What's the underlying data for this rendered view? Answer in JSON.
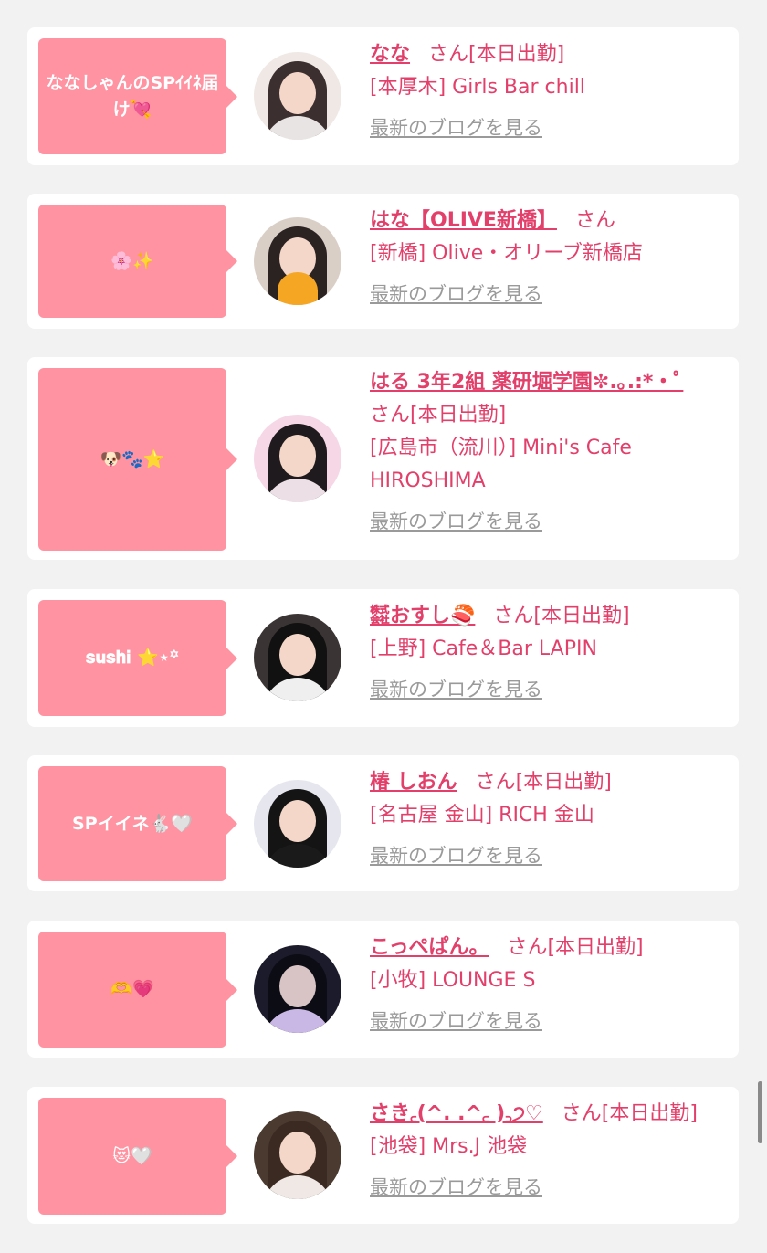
{
  "colors": {
    "accent": "#e2406b",
    "bubble": "#ff93a1",
    "link_gray": "#9a9a9a"
  },
  "blog_link_label": "最新のブログを見る",
  "cards": [
    {
      "message": "ななしゃんのSPｲｲﾈ届け💘",
      "name": "なな",
      "status": "さん[本日出勤]",
      "shop_line1": "[本厚木] Girls Bar chill",
      "shop_line2": "",
      "blog": "最新のブログを見る",
      "avatar_colors": [
        "#efe8e4",
        "#3b2f2f",
        "#f1d9cf"
      ]
    },
    {
      "message": "🌸✨",
      "name": "はな【OLIVE新橋】",
      "status": "さん",
      "shop_line1": "[新橋] Olive・オリーブ新橋店",
      "shop_line2": "",
      "blog": "最新のブログを見る",
      "avatar_colors": [
        "#d9cfc6",
        "#2b2222",
        "#f5a623"
      ]
    },
    {
      "message": "🐶🐾⭐",
      "name": "はる 3年2組 薬研堀学園✼.｡.:*・ﾟ",
      "status": "さん[本日出勤]",
      "shop_line1": "[広島市（流川）] Mini's Cafe",
      "shop_line2": "HIROSHIMA",
      "blog": "最新のブログを見る",
      "avatar_colors": [
        "#f6d7e6",
        "#1f1a1d",
        "#d23c8c"
      ]
    },
    {
      "message": "𝐬𝐮𝐬𝐡𝐢 ⭐⋆꙳",
      "name": "㍿おすし🍣",
      "status": "さん[本日出勤]",
      "shop_line1": "[上野] Cafe＆Bar LAPIN",
      "shop_line2": "",
      "blog": "最新のブログを見る",
      "avatar_colors": [
        "#3a3434",
        "#111111",
        "#efefef"
      ]
    },
    {
      "message": "SPイイネ🐇🤍",
      "name": "椿 しおん",
      "status": "さん[本日出勤]",
      "shop_line1": "[名古屋 金山] RICH 金山",
      "shop_line2": "",
      "blog": "最新のブログを見る",
      "avatar_colors": [
        "#e6e6ee",
        "#141414",
        "#f3f3f3"
      ]
    },
    {
      "message": "🫶💗",
      "name": "こっぺぱん。",
      "status": "さん[本日出勤]",
      "shop_line1": "[小牧] LOUNGE S",
      "shop_line2": "",
      "blog": "最新のブログを見る",
      "avatar_colors": [
        "#1c1b2b",
        "#0c0c14",
        "#c9b8e6"
      ]
    },
    {
      "message": "😻🤍",
      "name": "さき꜀(^. .^꜀ )꜆੭♡",
      "status": "さん[本日出勤]",
      "shop_line1": "[池袋] Mrs.J 池袋",
      "shop_line2": "",
      "blog": "最新のブログを見る",
      "avatar_colors": [
        "#4a3a30",
        "#3a2a22",
        "#f0e8e4"
      ]
    }
  ]
}
